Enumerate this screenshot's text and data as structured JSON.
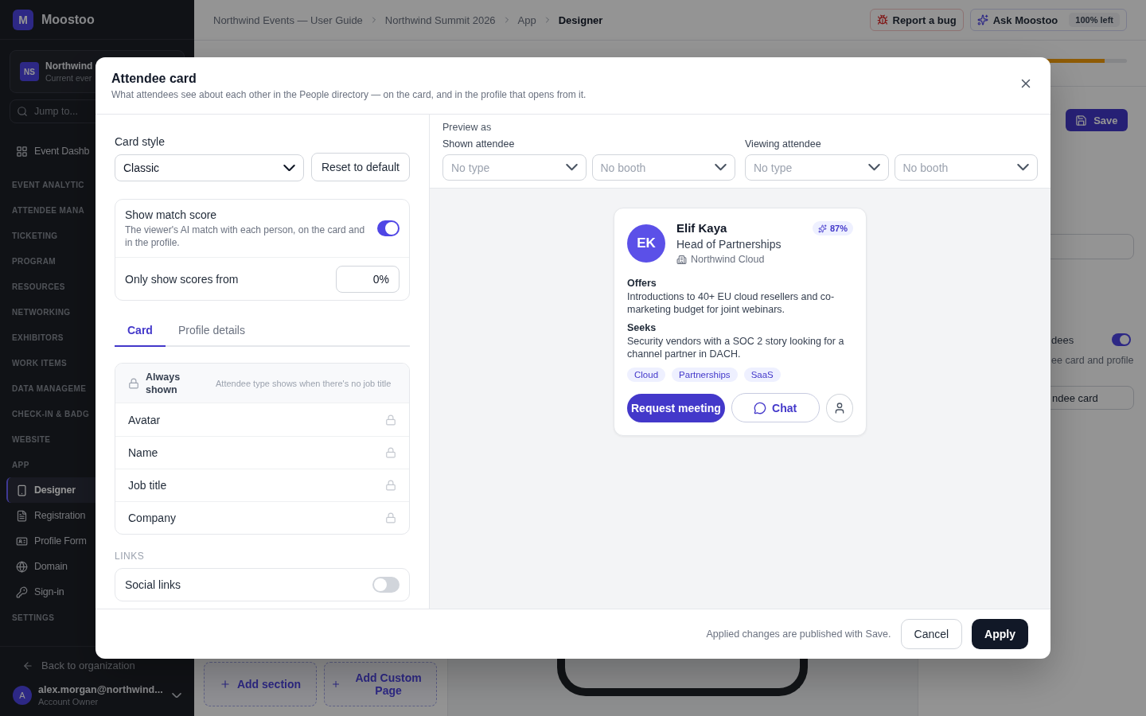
{
  "sidebar": {
    "brand": {
      "letter": "M",
      "name": "Moostoo"
    },
    "event": {
      "initials": "NS",
      "name": "Northwind",
      "subtitle": "Current ever"
    },
    "search": {
      "placeholder": "Jump to..."
    },
    "nav": [
      {
        "kind": "link",
        "label": "Event Dashb",
        "selected": false
      },
      {
        "kind": "section",
        "label": "EVENT ANALYTIC"
      },
      {
        "kind": "section",
        "label": "ATTENDEE MANA"
      },
      {
        "kind": "section",
        "label": "TICKETING"
      },
      {
        "kind": "section",
        "label": "PROGRAM"
      },
      {
        "kind": "section",
        "label": "RESOURCES"
      },
      {
        "kind": "section",
        "label": "NETWORKING"
      },
      {
        "kind": "section",
        "label": "EXHIBITORS"
      },
      {
        "kind": "section",
        "label": "WORK ITEMS"
      },
      {
        "kind": "section",
        "label": "DATA MANAGEME"
      },
      {
        "kind": "section",
        "label": "CHECK-IN & BADG"
      },
      {
        "kind": "section",
        "label": "WEBSITE"
      },
      {
        "kind": "section",
        "label": "APP"
      },
      {
        "kind": "link",
        "label": "Designer",
        "selected": true
      },
      {
        "kind": "link",
        "label": "Registration",
        "selected": false
      },
      {
        "kind": "link",
        "label": "Profile Form",
        "selected": false
      },
      {
        "kind": "link",
        "label": "Domain",
        "selected": false
      },
      {
        "kind": "link",
        "label": "Sign-in",
        "selected": false
      },
      {
        "kind": "section",
        "label": "SETTINGS"
      }
    ],
    "back_link": "Back to organization",
    "account": {
      "initial": "A",
      "email": "alex.morgan@northwind...",
      "role": "Account Owner"
    }
  },
  "topbar": {
    "breadcrumbs": [
      {
        "label": "Northwind Events — User Guide",
        "current": false
      },
      {
        "label": "Northwind Summit 2026",
        "current": false
      },
      {
        "label": "App",
        "current": false
      },
      {
        "label": "Designer",
        "current": true
      }
    ],
    "report_bug": "Report a bug",
    "assistant": {
      "label": "Ask Moostoo",
      "quota": "100% left"
    }
  },
  "page": {
    "progress": {
      "level": 0.78
    },
    "save": "Save",
    "add_section": "Add section",
    "add_page": "Add Custom Page",
    "settings_panel": {
      "toggle_label": "dees",
      "toggle_on": true,
      "toggle_hint": "ee card and profile",
      "button": "ndee card"
    }
  },
  "dialog": {
    "title": "Attendee card",
    "subtitle": "What attendees see about each other in the People directory — on the card, and in the profile that opens from it.",
    "card_style": {
      "label": "Card style",
      "value": "Classic",
      "reset": "Reset to default"
    },
    "match_score": {
      "title": "Show match score",
      "description": "The viewer's AI match with each person, on the card and in the profile.",
      "on": true,
      "threshold_label": "Only show scores from",
      "threshold_value": "0%"
    },
    "tabs": [
      {
        "label": "Card",
        "selected": true
      },
      {
        "label": "Profile details",
        "selected": false
      }
    ],
    "fields": {
      "header": "Always shown",
      "hint": "Attendee type shows when there's no job title",
      "rows": [
        {
          "label": "Avatar",
          "locked": true
        },
        {
          "label": "Name",
          "locked": true
        },
        {
          "label": "Job title",
          "locked": true
        },
        {
          "label": "Company",
          "locked": true
        }
      ]
    },
    "links": {
      "heading": "LINKS",
      "items": [
        {
          "label": "Social links",
          "on": false
        }
      ]
    },
    "preview": {
      "heading": "Preview as",
      "groups": [
        {
          "label": "Shown attendee",
          "selects": [
            {
              "placeholder": "No type"
            },
            {
              "placeholder": "No booth"
            }
          ]
        },
        {
          "label": "Viewing attendee",
          "selects": [
            {
              "placeholder": "No type"
            },
            {
              "placeholder": "No booth"
            }
          ]
        }
      ],
      "card": {
        "initials": "EK",
        "name": "Elif Kaya",
        "job_title": "Head of Partnerships",
        "company": "Northwind Cloud",
        "match": "87%",
        "sections": [
          {
            "heading": "Offers",
            "text": "Introductions to 40+ EU cloud resellers and co-marketing budget for joint webinars."
          },
          {
            "heading": "Seeks",
            "text": "Security vendors with a SOC 2 story looking for a channel partner in DACH."
          }
        ],
        "tags": [
          "Cloud",
          "Partnerships",
          "SaaS"
        ],
        "primary_action": "Request meeting",
        "secondary_action": "Chat"
      }
    },
    "footer": {
      "note": "Applied changes are published with Save.",
      "cancel": "Cancel",
      "apply": "Apply"
    }
  }
}
